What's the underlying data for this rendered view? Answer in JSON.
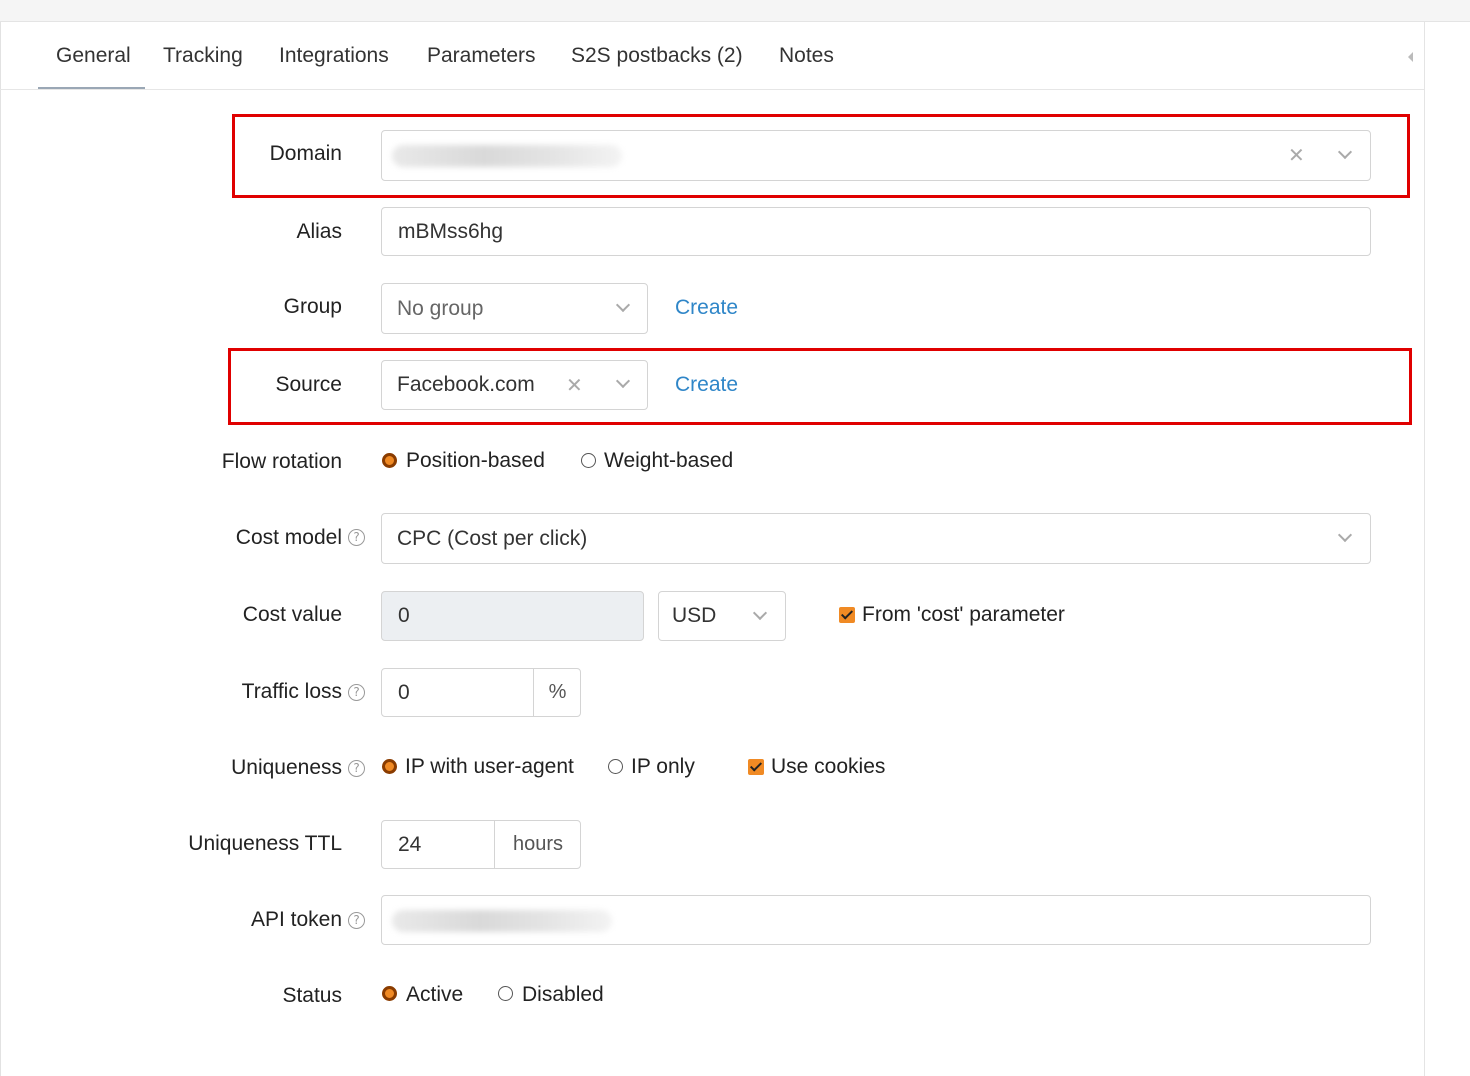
{
  "tabs": [
    {
      "label": "General"
    },
    {
      "label": "Tracking"
    },
    {
      "label": "Integrations"
    },
    {
      "label": "Parameters"
    },
    {
      "label": "S2S postbacks (2)"
    },
    {
      "label": "Notes"
    }
  ],
  "active_tab": "General",
  "form": {
    "domain": {
      "label": "Domain",
      "value_hidden": true
    },
    "alias": {
      "label": "Alias",
      "value": "mBMss6hg"
    },
    "group": {
      "label": "Group",
      "value": "No group",
      "create_label": "Create"
    },
    "source": {
      "label": "Source",
      "value": "Facebook.com",
      "create_label": "Create"
    },
    "flow_rotation": {
      "label": "Flow rotation",
      "options": [
        "Position-based",
        "Weight-based"
      ],
      "selected": "Position-based"
    },
    "cost_model": {
      "label": "Cost model",
      "value": "CPC (Cost per click)"
    },
    "cost_value": {
      "label": "Cost value",
      "value": "0",
      "currency": "USD",
      "from_param_label": "From 'cost' parameter",
      "from_param_checked": true
    },
    "traffic_loss": {
      "label": "Traffic loss",
      "value": "0",
      "unit": "%"
    },
    "uniqueness": {
      "label": "Uniqueness",
      "options": [
        "IP with user-agent",
        "IP only"
      ],
      "selected": "IP with user-agent",
      "cookies_label": "Use cookies",
      "cookies_checked": true
    },
    "uniqueness_ttl": {
      "label": "Uniqueness TTL",
      "value": "24",
      "unit": "hours"
    },
    "api_token": {
      "label": "API token",
      "value_hidden": true
    },
    "status": {
      "label": "Status",
      "options": [
        "Active",
        "Disabled"
      ],
      "selected": "Active"
    }
  },
  "colors": {
    "accent": "#f08a24",
    "link": "#2f86c8",
    "highlight_box": "#e00000"
  }
}
